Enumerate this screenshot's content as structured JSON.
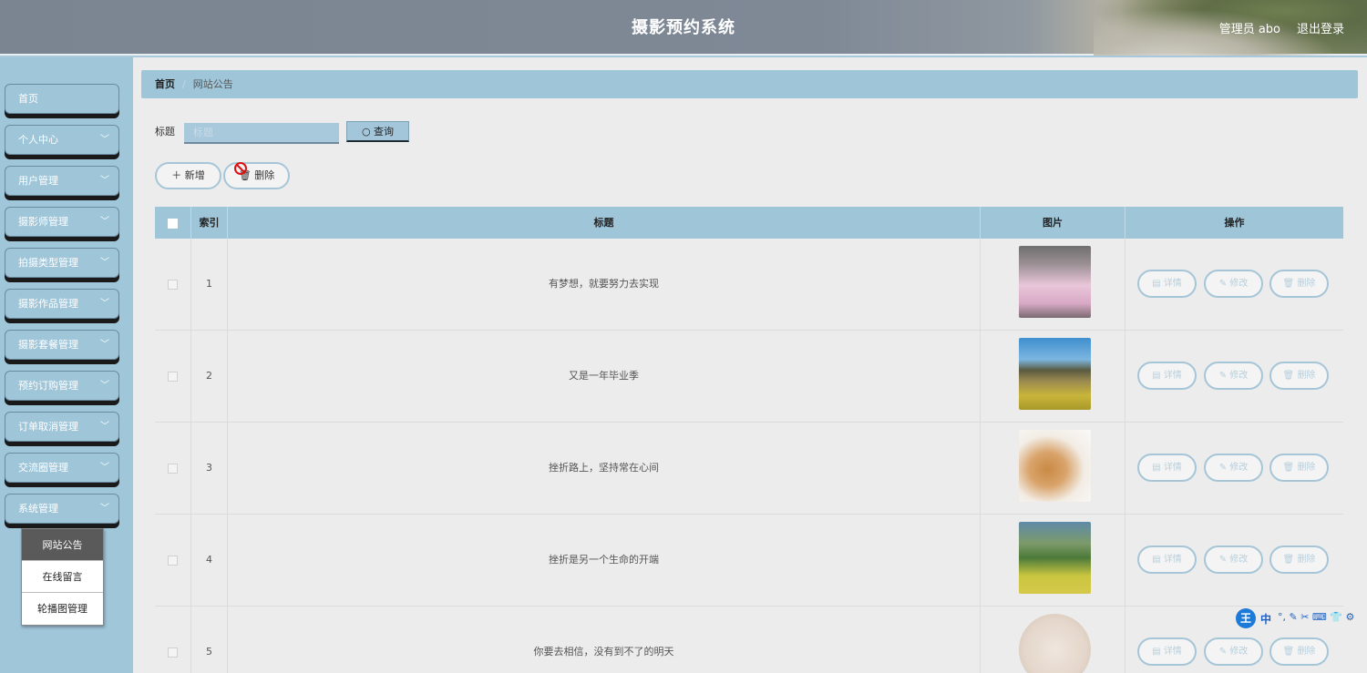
{
  "header": {
    "title": "摄影预约系统",
    "user": "管理员 abo",
    "logout": "退出登录"
  },
  "sidebar": {
    "items": [
      {
        "label": "首页",
        "has_chevron": false
      },
      {
        "label": "个人中心",
        "has_chevron": true
      },
      {
        "label": "用户管理",
        "has_chevron": true
      },
      {
        "label": "摄影师管理",
        "has_chevron": true
      },
      {
        "label": "拍摄类型管理",
        "has_chevron": true
      },
      {
        "label": "摄影作品管理",
        "has_chevron": true
      },
      {
        "label": "摄影套餐管理",
        "has_chevron": true
      },
      {
        "label": "预约订购管理",
        "has_chevron": true
      },
      {
        "label": "订单取消管理",
        "has_chevron": true
      },
      {
        "label": "交流圈管理",
        "has_chevron": true
      },
      {
        "label": "系统管理",
        "has_chevron": true
      }
    ],
    "submenu": [
      {
        "label": "网站公告",
        "active": true
      },
      {
        "label": "在线留言",
        "active": false
      },
      {
        "label": "轮播图管理",
        "active": false
      }
    ]
  },
  "breadcrumb": {
    "home": "首页",
    "separator": "/",
    "current": "网站公告"
  },
  "search": {
    "label": "标题",
    "placeholder": "标题",
    "button": "查询"
  },
  "actions": {
    "add": "新增",
    "delete": "删除"
  },
  "table": {
    "headers": [
      "",
      "索引",
      "标题",
      "图片",
      "操作"
    ],
    "rows": [
      {
        "index": "1",
        "title": "有梦想，就要努力去实现",
        "image": "two-girls-hanfu-photo"
      },
      {
        "index": "2",
        "title": "又是一年毕业季",
        "image": "photographer-field-photo"
      },
      {
        "index": "3",
        "title": "挫折路上，坚持常在心间",
        "image": "puppy-kitten-photo"
      },
      {
        "index": "4",
        "title": "挫折是另一个生命的开端",
        "image": "girl-flower-field-photo"
      },
      {
        "index": "5",
        "title": "你要去相信，没有到不了的明天",
        "image": "plum-blossom-painting"
      }
    ],
    "ops": {
      "detail": "详情",
      "edit": "修改",
      "delete": "删除"
    }
  },
  "ime_bar": {
    "logo": "王",
    "mode": "中",
    "tools": "°, ✎ ✂ ⌨ 👕 ⚙"
  },
  "colors": {
    "accent": "#9fc5d9",
    "header_bg": "#7b8591",
    "content_bg": "#ececec"
  }
}
